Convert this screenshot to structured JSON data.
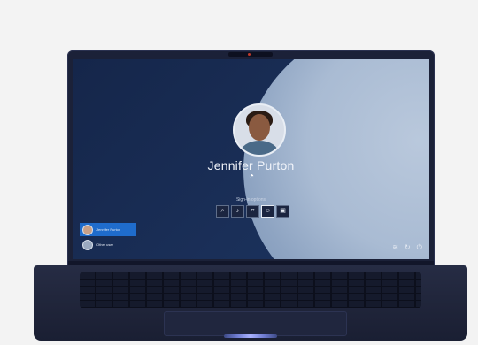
{
  "lock_screen": {
    "user_name": "Jennifer Purton",
    "signin_options_label": "Sign-in options",
    "signin_options": [
      {
        "icon": "magnifier-icon"
      },
      {
        "icon": "microphone-icon"
      },
      {
        "icon": "fingerprint-icon"
      },
      {
        "icon": "face-icon"
      },
      {
        "icon": "security-key-icon"
      }
    ],
    "users": [
      {
        "label": "Jennifer Purton",
        "active": true
      },
      {
        "label": "Other user",
        "active": false
      }
    ],
    "corner_icons": [
      "wifi-icon",
      "accessibility-icon",
      "power-icon"
    ]
  },
  "colors": {
    "background": "#f3f3f3",
    "screen": "#1a2f58",
    "accent": "#1f6ccc"
  }
}
